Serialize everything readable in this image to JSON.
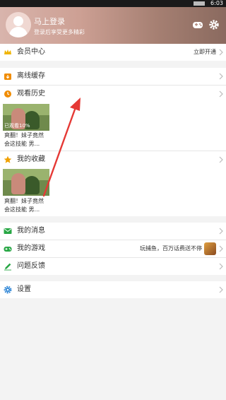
{
  "statusbar": {
    "time": "6:03"
  },
  "header": {
    "title": "马上登录",
    "subtitle": "登录后享受更多精彩"
  },
  "menu": {
    "vip": {
      "label": "会员中心",
      "right": "立即开通"
    },
    "offline": {
      "label": "离线缓存"
    },
    "history": {
      "label": "观看历史",
      "item": {
        "caption": "已观看10%",
        "title_line1": "爽翻！妹子竟然",
        "title_line2": "会这技能   男..."
      }
    },
    "favorites": {
      "label": "我的收藏",
      "item": {
        "title_line1": "爽翻！妹子竟然",
        "title_line2": "会这技能   男..."
      }
    },
    "messages": {
      "label": "我的消息"
    },
    "games": {
      "label": "我的游戏",
      "right": "玩捕鱼，百万话费送不停"
    },
    "feedback": {
      "label": "问题反馈"
    },
    "settings": {
      "label": "设置"
    }
  },
  "colors": {
    "vip": "#f0b400",
    "offline": "#f08c00",
    "history": "#f08c00",
    "favorites": "#f0a000",
    "messages": "#28a745",
    "games": "#28a745",
    "feedback": "#28a745",
    "settings": "#2f86d6"
  }
}
